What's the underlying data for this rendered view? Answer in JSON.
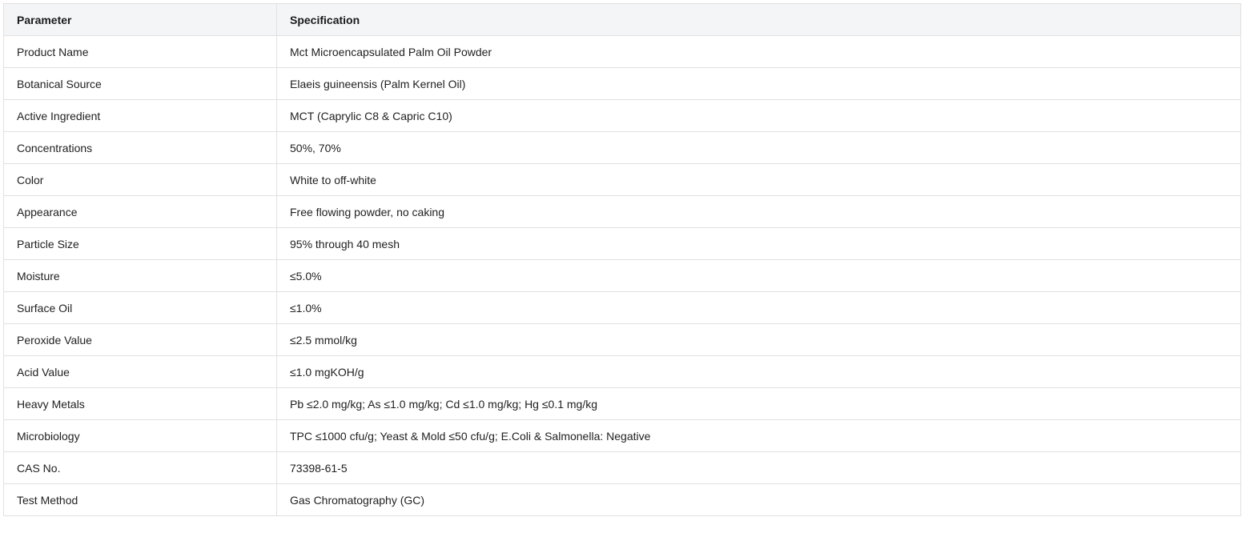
{
  "table": {
    "headers": {
      "parameter": "Parameter",
      "specification": "Specification"
    },
    "rows": [
      {
        "parameter": "Product Name",
        "specification": "Mct Microencapsulated Palm Oil Powder"
      },
      {
        "parameter": "Botanical Source",
        "specification": "Elaeis guineensis (Palm Kernel Oil)"
      },
      {
        "parameter": "Active Ingredient",
        "specification": "MCT (Caprylic C8 & Capric C10)"
      },
      {
        "parameter": "Concentrations",
        "specification": "50%, 70%"
      },
      {
        "parameter": "Color",
        "specification": "White to off-white"
      },
      {
        "parameter": "Appearance",
        "specification": "Free flowing powder, no caking"
      },
      {
        "parameter": "Particle Size",
        "specification": "95% through 40 mesh"
      },
      {
        "parameter": "Moisture",
        "specification": "≤5.0%"
      },
      {
        "parameter": "Surface Oil",
        "specification": "≤1.0%"
      },
      {
        "parameter": "Peroxide Value",
        "specification": "≤2.5 mmol/kg"
      },
      {
        "parameter": "Acid Value",
        "specification": "≤1.0 mgKOH/g"
      },
      {
        "parameter": "Heavy Metals",
        "specification": "Pb ≤2.0 mg/kg; As ≤1.0 mg/kg; Cd ≤1.0 mg/kg; Hg ≤0.1 mg/kg"
      },
      {
        "parameter": "Microbiology",
        "specification": "TPC ≤1000 cfu/g; Yeast & Mold ≤50 cfu/g; E.Coli & Salmonella: Negative"
      },
      {
        "parameter": "CAS No.",
        "specification": "73398-61-5"
      },
      {
        "parameter": "Test Method",
        "specification": "Gas Chromatography (GC)"
      }
    ]
  }
}
